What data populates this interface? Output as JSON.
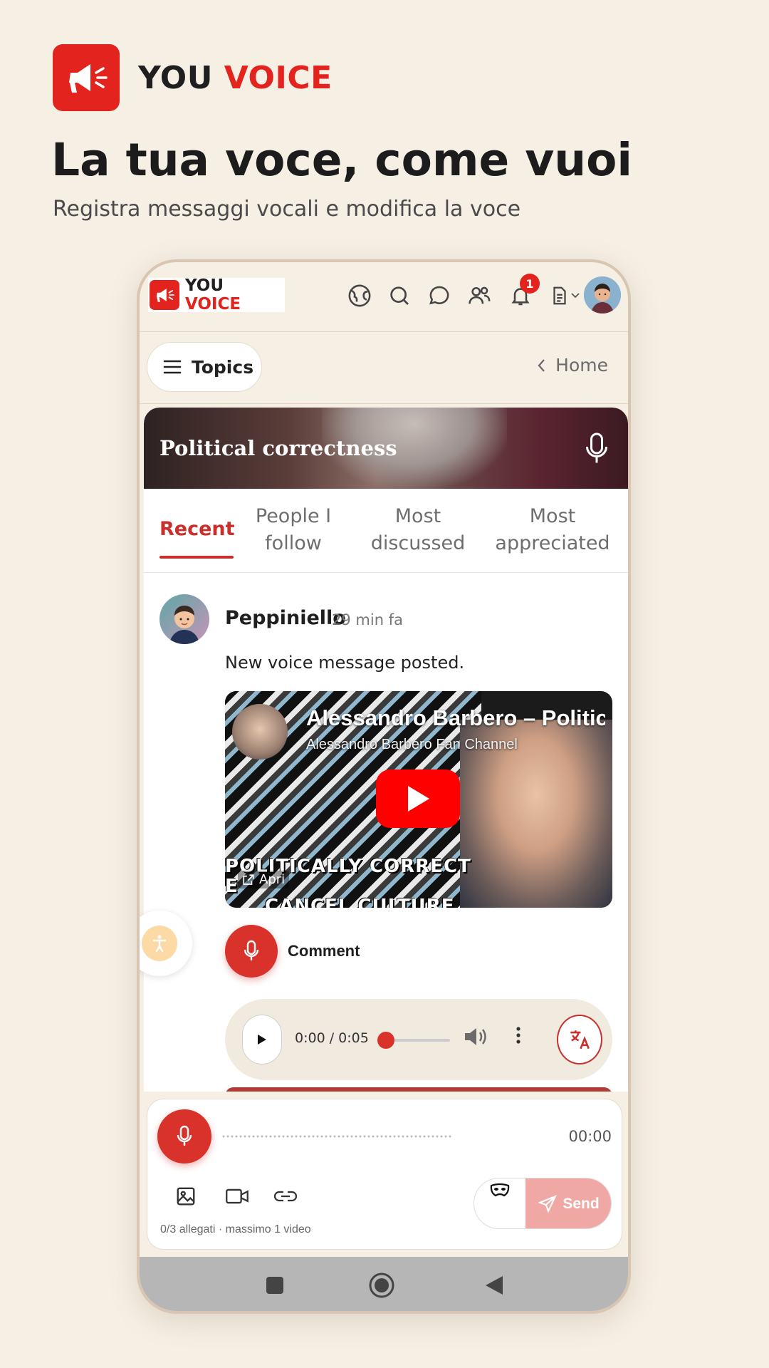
{
  "promo": {
    "brand_you": "YOU",
    "brand_voice": "VOICE",
    "headline": "La tua voce, come vuoi",
    "subline": "Registra messaggi vocali e modifica la voce"
  },
  "app": {
    "logo_you": "YOU",
    "logo_voice": "VOICE",
    "notification_count": "1",
    "topics_label": "Topics",
    "home_label": "Home"
  },
  "topic": {
    "title": "Political correctness",
    "tabs": [
      {
        "label": "Recent",
        "active": true
      },
      {
        "label": "People I follow",
        "active": false
      },
      {
        "label": "Most discussed",
        "active": false
      },
      {
        "label": "Most appreciated",
        "active": false
      }
    ]
  },
  "post": {
    "username": "Peppiniello",
    "time": "29 min fa",
    "text": "New voice message posted.",
    "video": {
      "title": "Alessandro Barbero – Politic",
      "channel": "Alessandro Barbero Fan Channel",
      "art_text_line1": "POLITICALLY CORRECT E",
      "art_text_line2": "CANCEL CULTURE",
      "open_label": "Apri"
    },
    "comment_label": "Comment",
    "player": {
      "time": "0:00 / 0:05",
      "progress": 0
    }
  },
  "composer": {
    "rec_time": "00:00",
    "attach_info": "0/3 allegati · massimo 1 video",
    "send_label": "Send"
  },
  "colors": {
    "accent": "#e3231d",
    "tab_active": "#c9302c",
    "background": "#f6efe4"
  }
}
